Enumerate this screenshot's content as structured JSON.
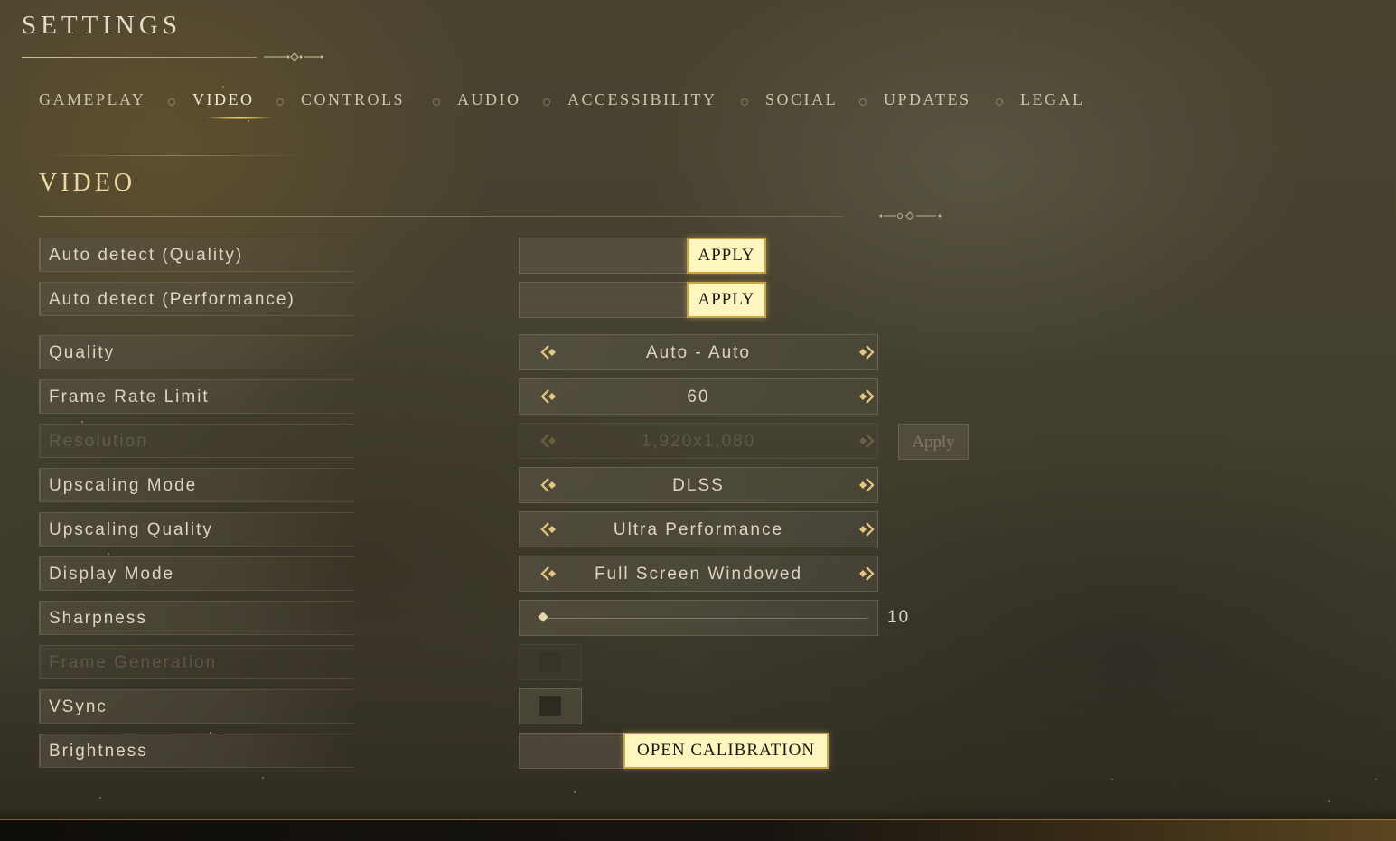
{
  "header": {
    "title": "SETTINGS"
  },
  "tabs": [
    {
      "label": "GAMEPLAY",
      "active": false
    },
    {
      "label": "VIDEO",
      "active": true
    },
    {
      "label": "CONTROLS",
      "active": false
    },
    {
      "label": "AUDIO",
      "active": false
    },
    {
      "label": "ACCESSIBILITY",
      "active": false
    },
    {
      "label": "SOCIAL",
      "active": false
    },
    {
      "label": "UPDATES",
      "active": false
    },
    {
      "label": "LEGAL",
      "active": false
    }
  ],
  "section": {
    "title": "VIDEO"
  },
  "settings": {
    "auto_quality": {
      "label": "Auto detect (Quality)",
      "button": "APPLY"
    },
    "auto_performance": {
      "label": "Auto detect (Performance)",
      "button": "APPLY"
    },
    "quality": {
      "label": "Quality",
      "value": "Auto - Auto"
    },
    "frame_rate_limit": {
      "label": "Frame Rate Limit",
      "value": "60"
    },
    "resolution": {
      "label": "Resolution",
      "value": "1,920x1,080",
      "button": "Apply",
      "disabled": true
    },
    "upscaling_mode": {
      "label": "Upscaling Mode",
      "value": "DLSS"
    },
    "upscaling_quality": {
      "label": "Upscaling Quality",
      "value": "Ultra Performance"
    },
    "display_mode": {
      "label": "Display Mode",
      "value": "Full Screen Windowed"
    },
    "sharpness": {
      "label": "Sharpness",
      "value": "10",
      "level_fraction": 0.0
    },
    "frame_generation": {
      "label": "Frame Generation",
      "checked": false,
      "disabled": true
    },
    "vsync": {
      "label": "VSync",
      "checked": false
    },
    "brightness": {
      "label": "Brightness",
      "button": "OPEN CALIBRATION"
    }
  },
  "icons": {
    "arrow_left": "chevron-left-icon",
    "arrow_right": "chevron-right-icon",
    "ornament": "ornament-divider-icon"
  },
  "colors": {
    "accent_gold": "#e8c77a",
    "button_face": "#fff6bf",
    "button_border": "#c9a545"
  }
}
